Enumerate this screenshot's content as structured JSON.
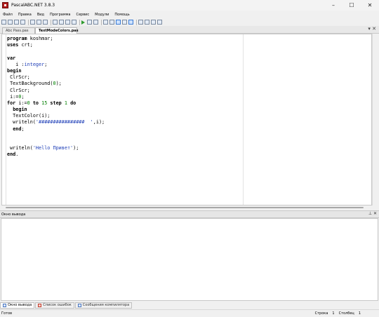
{
  "window": {
    "title": "PascalABC.NET 3.8.3",
    "controls": {
      "minimize": "–",
      "maximize": "☐",
      "close": "✕"
    }
  },
  "menu": [
    "Файл",
    "Правка",
    "Вид",
    "Программа",
    "Сервис",
    "Модули",
    "Помощь"
  ],
  "toolbar": {
    "buttons": [
      "new-file-icon",
      "open-icon",
      "save-icon",
      "save-all-icon",
      "cut-icon",
      "copy-icon",
      "paste-icon",
      "undo-icon",
      "redo-icon",
      "find-icon",
      "replace-icon",
      "run-icon",
      "stop-icon",
      "debug-icon",
      "step-icon",
      "step-into-icon",
      "step-over-icon",
      "form-icon",
      "window-icon",
      "layout-icon",
      "grid-icon",
      "split-icon",
      "tile-icon",
      "cascade-icon"
    ]
  },
  "tabs": [
    {
      "label": "Abc Pass.pas",
      "active": false
    },
    {
      "label": "TextModeColors.pas",
      "active": true
    }
  ],
  "tabs_close": "▾ ✕",
  "code": [
    {
      "segments": [
        {
          "t": "program",
          "c": "kw"
        },
        {
          "t": " koshmar;",
          "c": ""
        }
      ]
    },
    {
      "segments": [
        {
          "t": "uses",
          "c": "kw"
        },
        {
          "t": " crt;",
          "c": ""
        }
      ]
    },
    {
      "segments": []
    },
    {
      "segments": [
        {
          "t": "var",
          "c": "kw"
        }
      ]
    },
    {
      "segments": [
        {
          "t": "   i :",
          "c": ""
        },
        {
          "t": "integer",
          "c": "type"
        },
        {
          "t": ";",
          "c": ""
        }
      ]
    },
    {
      "segments": [
        {
          "t": "begin",
          "c": "kw"
        }
      ]
    },
    {
      "segments": [
        {
          "t": " ClrScr;",
          "c": ""
        }
      ]
    },
    {
      "segments": [
        {
          "t": " TextBackground(",
          "c": ""
        },
        {
          "t": "0",
          "c": "num"
        },
        {
          "t": ");",
          "c": ""
        }
      ]
    },
    {
      "segments": [
        {
          "t": " ClrScr;",
          "c": ""
        }
      ]
    },
    {
      "segments": [
        {
          "t": " i:=",
          "c": ""
        },
        {
          "t": "0",
          "c": "num"
        },
        {
          "t": ";",
          "c": ""
        }
      ]
    },
    {
      "segments": [
        {
          "t": "for",
          "c": "kw"
        },
        {
          "t": " i:=",
          "c": ""
        },
        {
          "t": "0",
          "c": "num"
        },
        {
          "t": " ",
          "c": ""
        },
        {
          "t": "to",
          "c": "kw"
        },
        {
          "t": " ",
          "c": ""
        },
        {
          "t": "15",
          "c": "num"
        },
        {
          "t": " ",
          "c": ""
        },
        {
          "t": "step",
          "c": "kw"
        },
        {
          "t": " ",
          "c": ""
        },
        {
          "t": "1",
          "c": "num"
        },
        {
          "t": " ",
          "c": ""
        },
        {
          "t": "do",
          "c": "kw"
        }
      ]
    },
    {
      "segments": [
        {
          "t": "  ",
          "c": ""
        },
        {
          "t": "begin",
          "c": "kw"
        }
      ]
    },
    {
      "segments": [
        {
          "t": "  TextColor(i);",
          "c": ""
        }
      ]
    },
    {
      "segments": [
        {
          "t": "  writeln(",
          "c": ""
        },
        {
          "t": "'################  '",
          "c": "str"
        },
        {
          "t": ",i);",
          "c": ""
        }
      ]
    },
    {
      "segments": [
        {
          "t": "  ",
          "c": ""
        },
        {
          "t": "end",
          "c": "kw"
        },
        {
          "t": ";",
          "c": ""
        }
      ]
    },
    {
      "segments": []
    },
    {
      "segments": []
    },
    {
      "segments": [
        {
          "t": " writeln(",
          "c": ""
        },
        {
          "t": "'Hello Привет'",
          "c": "str"
        },
        {
          "t": ");",
          "c": ""
        }
      ]
    },
    {
      "segments": [
        {
          "t": "end",
          "c": "kw"
        },
        {
          "t": ".",
          "c": ""
        }
      ]
    }
  ],
  "output": {
    "title": "Окно вывода",
    "controls": "⊥ ✕",
    "content": ""
  },
  "bottom_tabs": [
    {
      "label": "Окно вывода",
      "active": true,
      "icon": "output-window-icon"
    },
    {
      "label": "Список ошибок",
      "active": false,
      "icon": "error-list-icon"
    },
    {
      "label": "Сообщения компилятора",
      "active": false,
      "icon": "compiler-messages-icon"
    }
  ],
  "status": {
    "left": "Готов",
    "line_label": "Строка",
    "line": "1",
    "col_label": "Столбец",
    "col": "1"
  }
}
